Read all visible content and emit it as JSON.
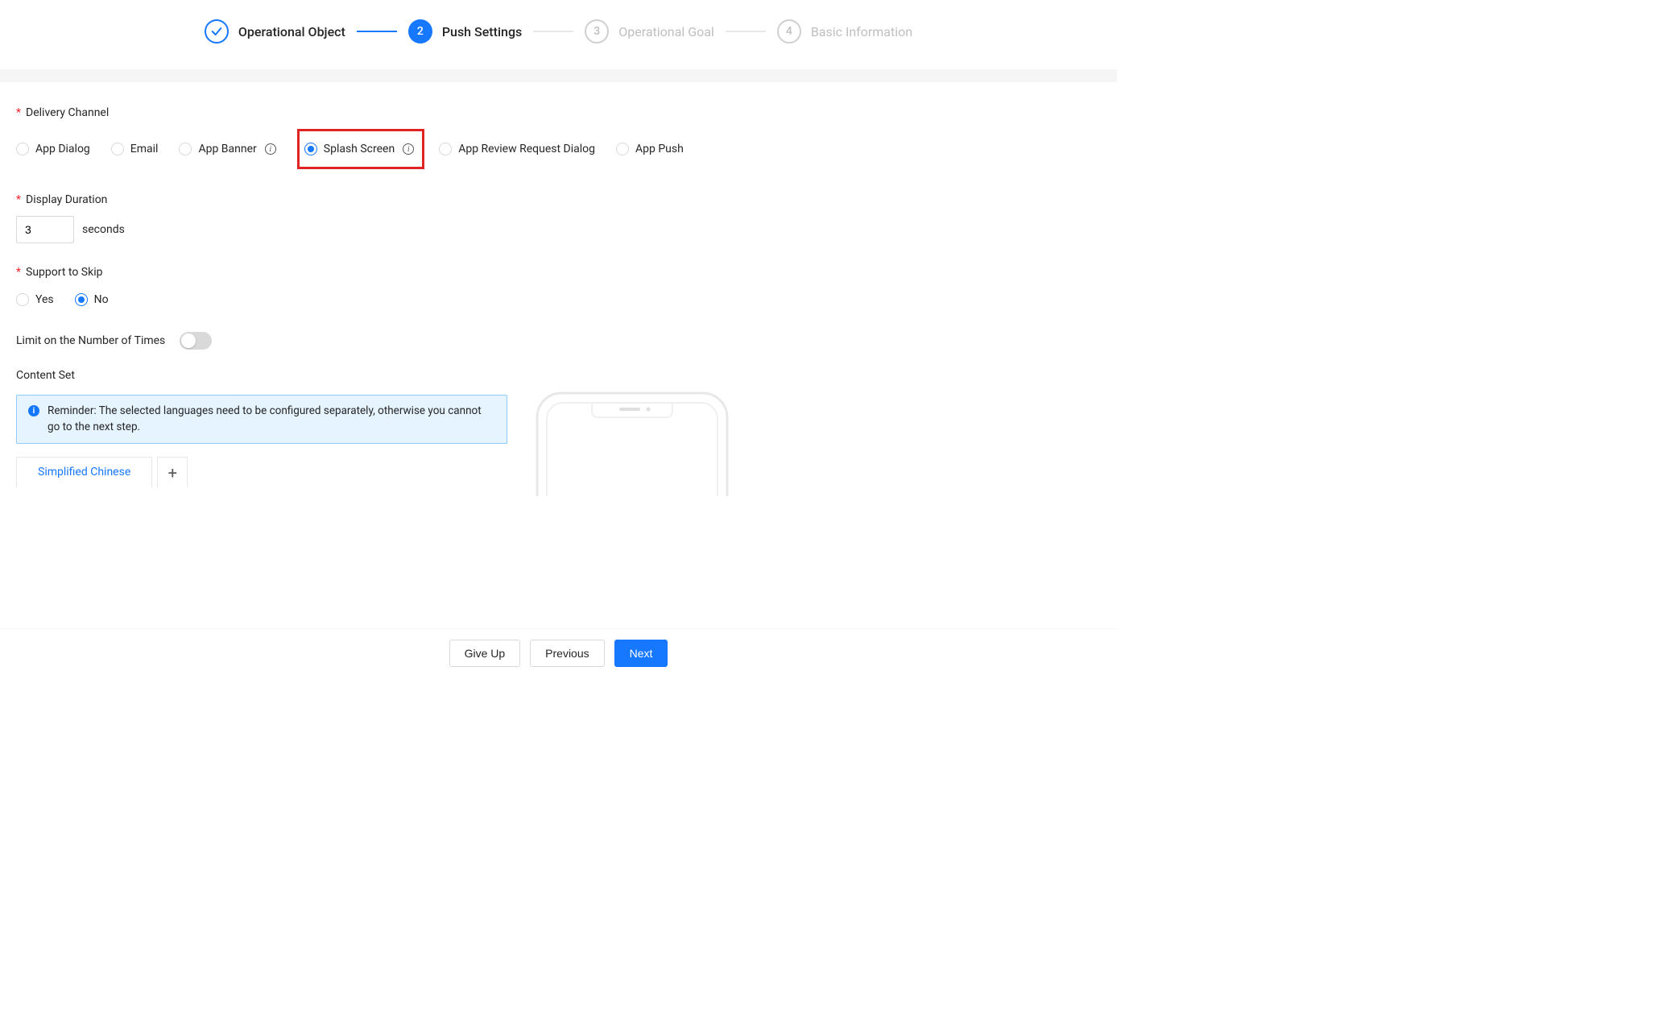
{
  "stepper": {
    "steps": [
      {
        "label": "Operational Object",
        "num": "1",
        "state": "done"
      },
      {
        "label": "Push Settings",
        "num": "2",
        "state": "current"
      },
      {
        "label": "Operational Goal",
        "num": "3",
        "state": "upcoming"
      },
      {
        "label": "Basic Information",
        "num": "4",
        "state": "upcoming"
      }
    ]
  },
  "labels": {
    "delivery_channel": "Delivery Channel",
    "display_duration": "Display Duration",
    "support_to_skip": "Support to Skip",
    "limit_times": "Limit on the Number of Times",
    "content_set": "Content Set",
    "seconds_unit": "seconds"
  },
  "delivery_channel": {
    "options": [
      {
        "key": "app_dialog",
        "label": "App Dialog",
        "info": false,
        "selected": false
      },
      {
        "key": "email",
        "label": "Email",
        "info": false,
        "selected": false
      },
      {
        "key": "app_banner",
        "label": "App Banner",
        "info": true,
        "selected": false
      },
      {
        "key": "splash",
        "label": "Splash Screen",
        "info": true,
        "selected": true,
        "highlight": true
      },
      {
        "key": "review",
        "label": "App Review Request Dialog",
        "info": false,
        "selected": false
      },
      {
        "key": "app_push",
        "label": "App Push",
        "info": false,
        "selected": false
      }
    ]
  },
  "display_duration": {
    "value": "3"
  },
  "support_to_skip": {
    "options": [
      {
        "key": "yes",
        "label": "Yes",
        "selected": false
      },
      {
        "key": "no",
        "label": "No",
        "selected": true
      }
    ]
  },
  "limit_times": {
    "on": false
  },
  "content_set": {
    "reminder": "Reminder: The selected languages need to be configured separately, otherwise you cannot go to the next step.",
    "tabs": [
      {
        "key": "zh_cn",
        "label": "Simplified Chinese",
        "active": true
      }
    ],
    "add_label": "+"
  },
  "actions": {
    "give_up": "Give Up",
    "previous": "Previous",
    "next": "Next"
  }
}
